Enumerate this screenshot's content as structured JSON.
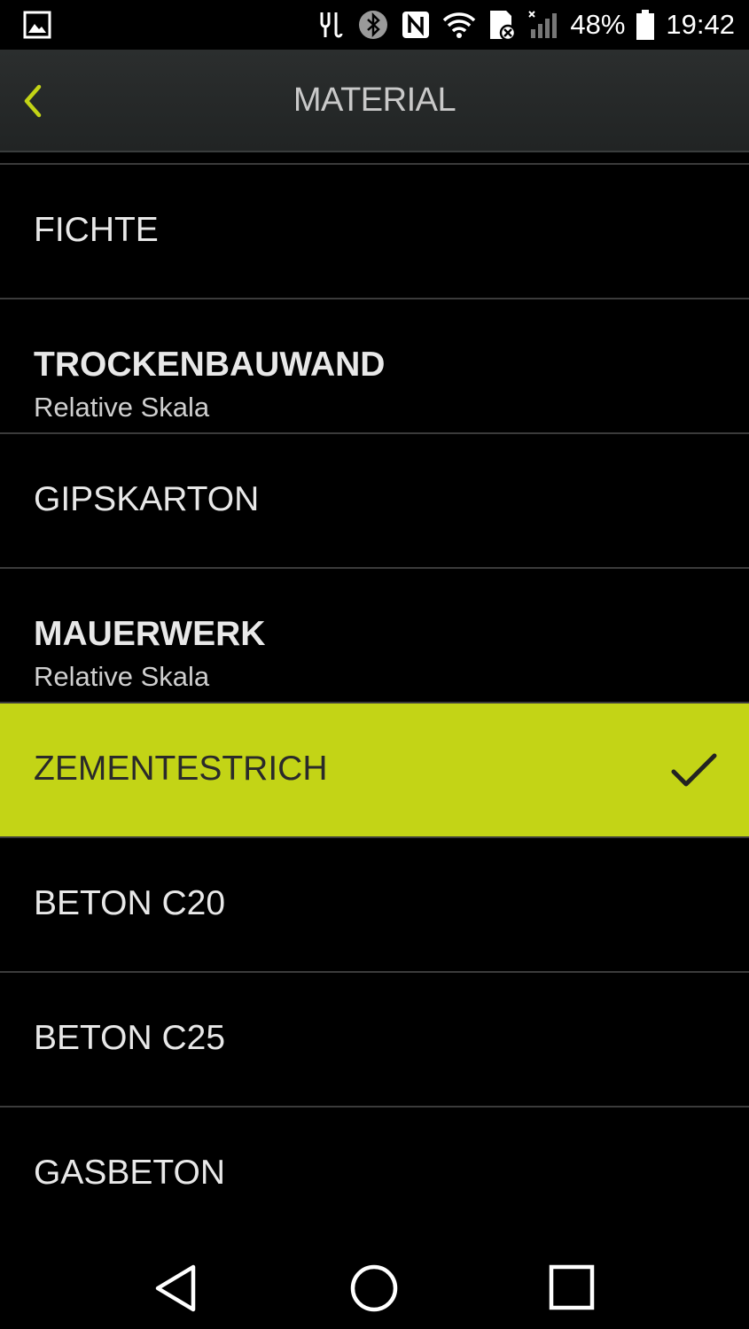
{
  "status_bar": {
    "battery": "48%",
    "time": "19:42",
    "icons": [
      "image-icon",
      "usb-icon",
      "bluetooth-icon",
      "nfc-icon",
      "wifi-icon",
      "sd-card-icon",
      "signal-icon",
      "battery-icon"
    ]
  },
  "app_bar": {
    "title": "MATERIAL",
    "back_icon": "chevron-left-icon"
  },
  "colors": {
    "accent": "#c3d416",
    "background": "#000000",
    "appbar": "#262929"
  },
  "materials": [
    {
      "label": "FICHTE"
    },
    {
      "label": "TROCKENBAUWAND",
      "sub": "Relative Skala"
    },
    {
      "label": "GIPSKARTON"
    },
    {
      "label": "MAUERWERK",
      "sub": "Relative Skala"
    },
    {
      "label": "ZEMENTESTRICH",
      "selected": true
    },
    {
      "label": "BETON C20"
    },
    {
      "label": "BETON C25"
    },
    {
      "label": "GASBETON"
    }
  ],
  "nav_bar": {
    "icons": [
      "back-triangle-icon",
      "home-circle-icon",
      "recents-square-icon"
    ]
  }
}
